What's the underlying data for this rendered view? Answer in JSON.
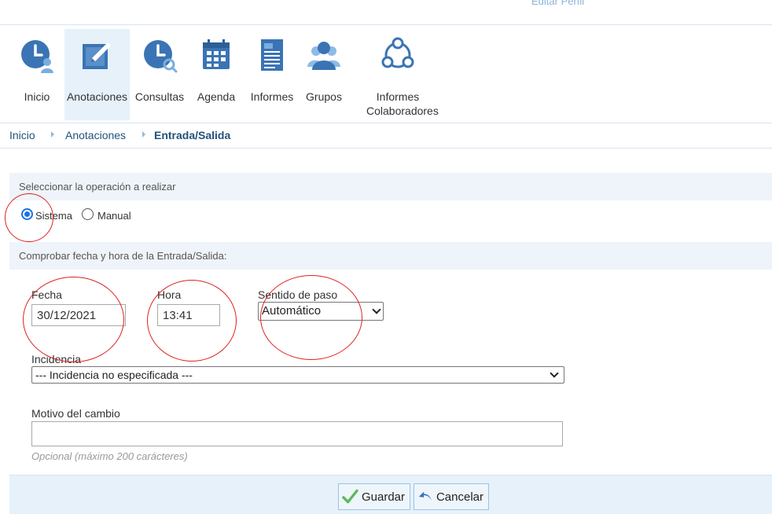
{
  "header": {
    "profile_link": "Editar Perfil"
  },
  "nav": {
    "items": [
      {
        "label": "Inicio",
        "icon": "clock-user-icon",
        "active": false
      },
      {
        "label": "Anotaciones",
        "icon": "edit-note-icon",
        "active": true
      },
      {
        "label": "Consultas",
        "icon": "clock-search-icon",
        "active": false
      },
      {
        "label": "Agenda",
        "icon": "calendar-icon",
        "active": false
      },
      {
        "label": "Informes",
        "icon": "document-icon",
        "active": false
      },
      {
        "label": "Grupos",
        "icon": "users-icon",
        "active": false
      },
      {
        "label": "Informes Colaboradores",
        "icon": "network-icon",
        "active": false
      }
    ]
  },
  "breadcrumb": {
    "items": [
      "Inicio",
      "Anotaciones",
      "Entrada/Salida"
    ]
  },
  "operation": {
    "heading": "Seleccionar la operación a realizar",
    "options": [
      {
        "label": "Sistema",
        "checked": true
      },
      {
        "label": "Manual",
        "checked": false
      }
    ]
  },
  "datetime": {
    "heading": "Comprobar fecha y hora de la Entrada/Salida:",
    "fecha_label": "Fecha",
    "fecha_value": "30/12/2021",
    "hora_label": "Hora",
    "hora_value": "13:41",
    "sentido_label": "Sentido de paso",
    "sentido_value": "Automático"
  },
  "incidencia": {
    "label": "Incidencia",
    "value": "--- Incidencia no especificada ---"
  },
  "motivo": {
    "label": "Motivo del cambio",
    "value": "",
    "hint": "Opcional (máximo 200 carácteres)"
  },
  "actions": {
    "save_label": "Guardar",
    "cancel_label": "Cancelar"
  },
  "colors": {
    "accent": "#1a73e8",
    "icon_blue": "#3a74b5",
    "panel": "#eef4fa",
    "annotation": "#e02020",
    "save_check": "#5cb85c"
  }
}
